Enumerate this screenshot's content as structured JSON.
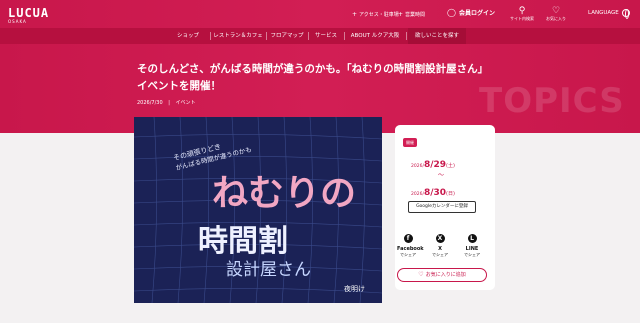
{
  "brand": {
    "logo": "LUCUA",
    "logo_sub": "OSAKA"
  },
  "utility": {
    "access": "アクセス・駐車場",
    "hours": "営業時間",
    "login": "会員ログイン",
    "site_search": "サイト内検索",
    "favorites": "お気に入り",
    "language": "LANGUAGE"
  },
  "nav": [
    {
      "label": "ショップ"
    },
    {
      "label": "レストラン＆カフェ"
    },
    {
      "label": "フロアマップ"
    },
    {
      "label": "サービス"
    },
    {
      "label": "ABOUT ルクア大阪"
    },
    {
      "label": "欲しいことを探す"
    }
  ],
  "article": {
    "title": "そのしんどさ、がんばる時間が違うのかも。「ねむりの時間割設計屋さん」イベントを開催！",
    "date": "2026/7/30",
    "separator": "|",
    "category": "イベント",
    "watermark": "TOPICS"
  },
  "poster": {
    "lead_line1": "その頑張りどき",
    "lead_line2": "がんばる時間が違うのかも",
    "title_big": "ねむりの",
    "title_mid": "時間割",
    "title_small": "設計屋さん",
    "stamp": "夜明け"
  },
  "event": {
    "badge": "開催",
    "start_year": "2026/",
    "start_md": "8/29",
    "start_dow": "(土)",
    "tilde": "〜",
    "end_year": "2026/",
    "end_md": "8/30",
    "end_dow": "(日)",
    "calendar_button": "Googleカレンダーに登録"
  },
  "share": [
    {
      "name": "Facebook",
      "label": "でシェア",
      "icon": "f"
    },
    {
      "name": "X",
      "label": "でシェア",
      "icon": "X"
    },
    {
      "name": "LINE",
      "label": "でシェア",
      "icon": "L"
    }
  ],
  "favorite_button": "お気に入りに追加",
  "colors": {
    "brand": "#d21e54",
    "nav": "#b6103f",
    "poster_bg": "#1b2256",
    "accent_pink": "#f2a7c3"
  }
}
